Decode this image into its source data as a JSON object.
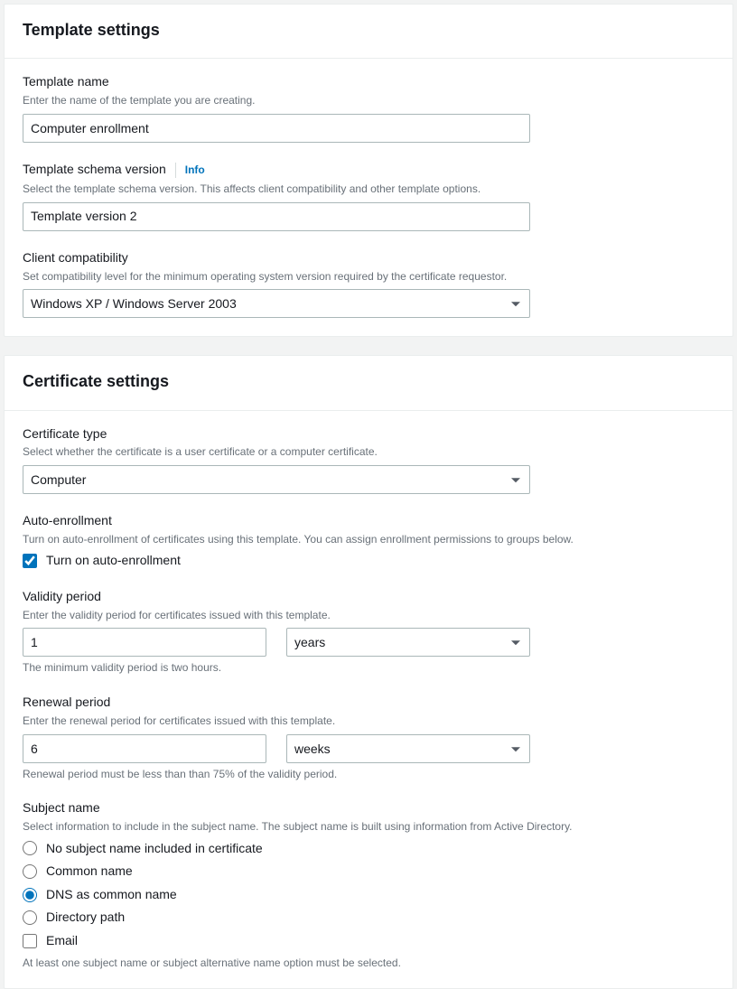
{
  "templateSettings": {
    "title": "Template settings",
    "templateName": {
      "label": "Template name",
      "desc": "Enter the name of the template you are creating.",
      "value": "Computer enrollment"
    },
    "schemaVersion": {
      "label": "Template schema version",
      "infoLabel": "Info",
      "desc": "Select the template schema version. This affects client compatibility and other template options.",
      "value": "Template version 2"
    },
    "clientCompat": {
      "label": "Client compatibility",
      "desc": "Set compatibility level for the minimum operating system version required by the certificate requestor.",
      "value": "Windows XP / Windows Server 2003"
    }
  },
  "certSettings": {
    "title": "Certificate settings",
    "certType": {
      "label": "Certificate type",
      "desc": "Select whether the certificate is a user certificate or a computer certificate.",
      "value": "Computer"
    },
    "autoEnroll": {
      "label": "Auto-enrollment",
      "desc": "Turn on auto-enrollment of certificates using this template. You can assign enrollment permissions to groups below.",
      "checkboxLabel": "Turn on auto-enrollment"
    },
    "validity": {
      "label": "Validity period",
      "desc": "Enter the validity period for certificates issued with this template.",
      "value": "1",
      "unit": "years",
      "hint": "The minimum validity period is two hours."
    },
    "renewal": {
      "label": "Renewal period",
      "desc": "Enter the renewal period for certificates issued with this template.",
      "value": "6",
      "unit": "weeks",
      "hint": "Renewal period must be less than than 75% of the validity period."
    },
    "subjectName": {
      "label": "Subject name",
      "desc": "Select information to include in the subject name. The subject name is built using information from Active Directory.",
      "options": {
        "none": "No subject name included in certificate",
        "common": "Common name",
        "dns": "DNS as common name",
        "dir": "Directory path",
        "email": "Email"
      },
      "hint": "At least one subject name or subject alternative name option must be selected."
    }
  }
}
